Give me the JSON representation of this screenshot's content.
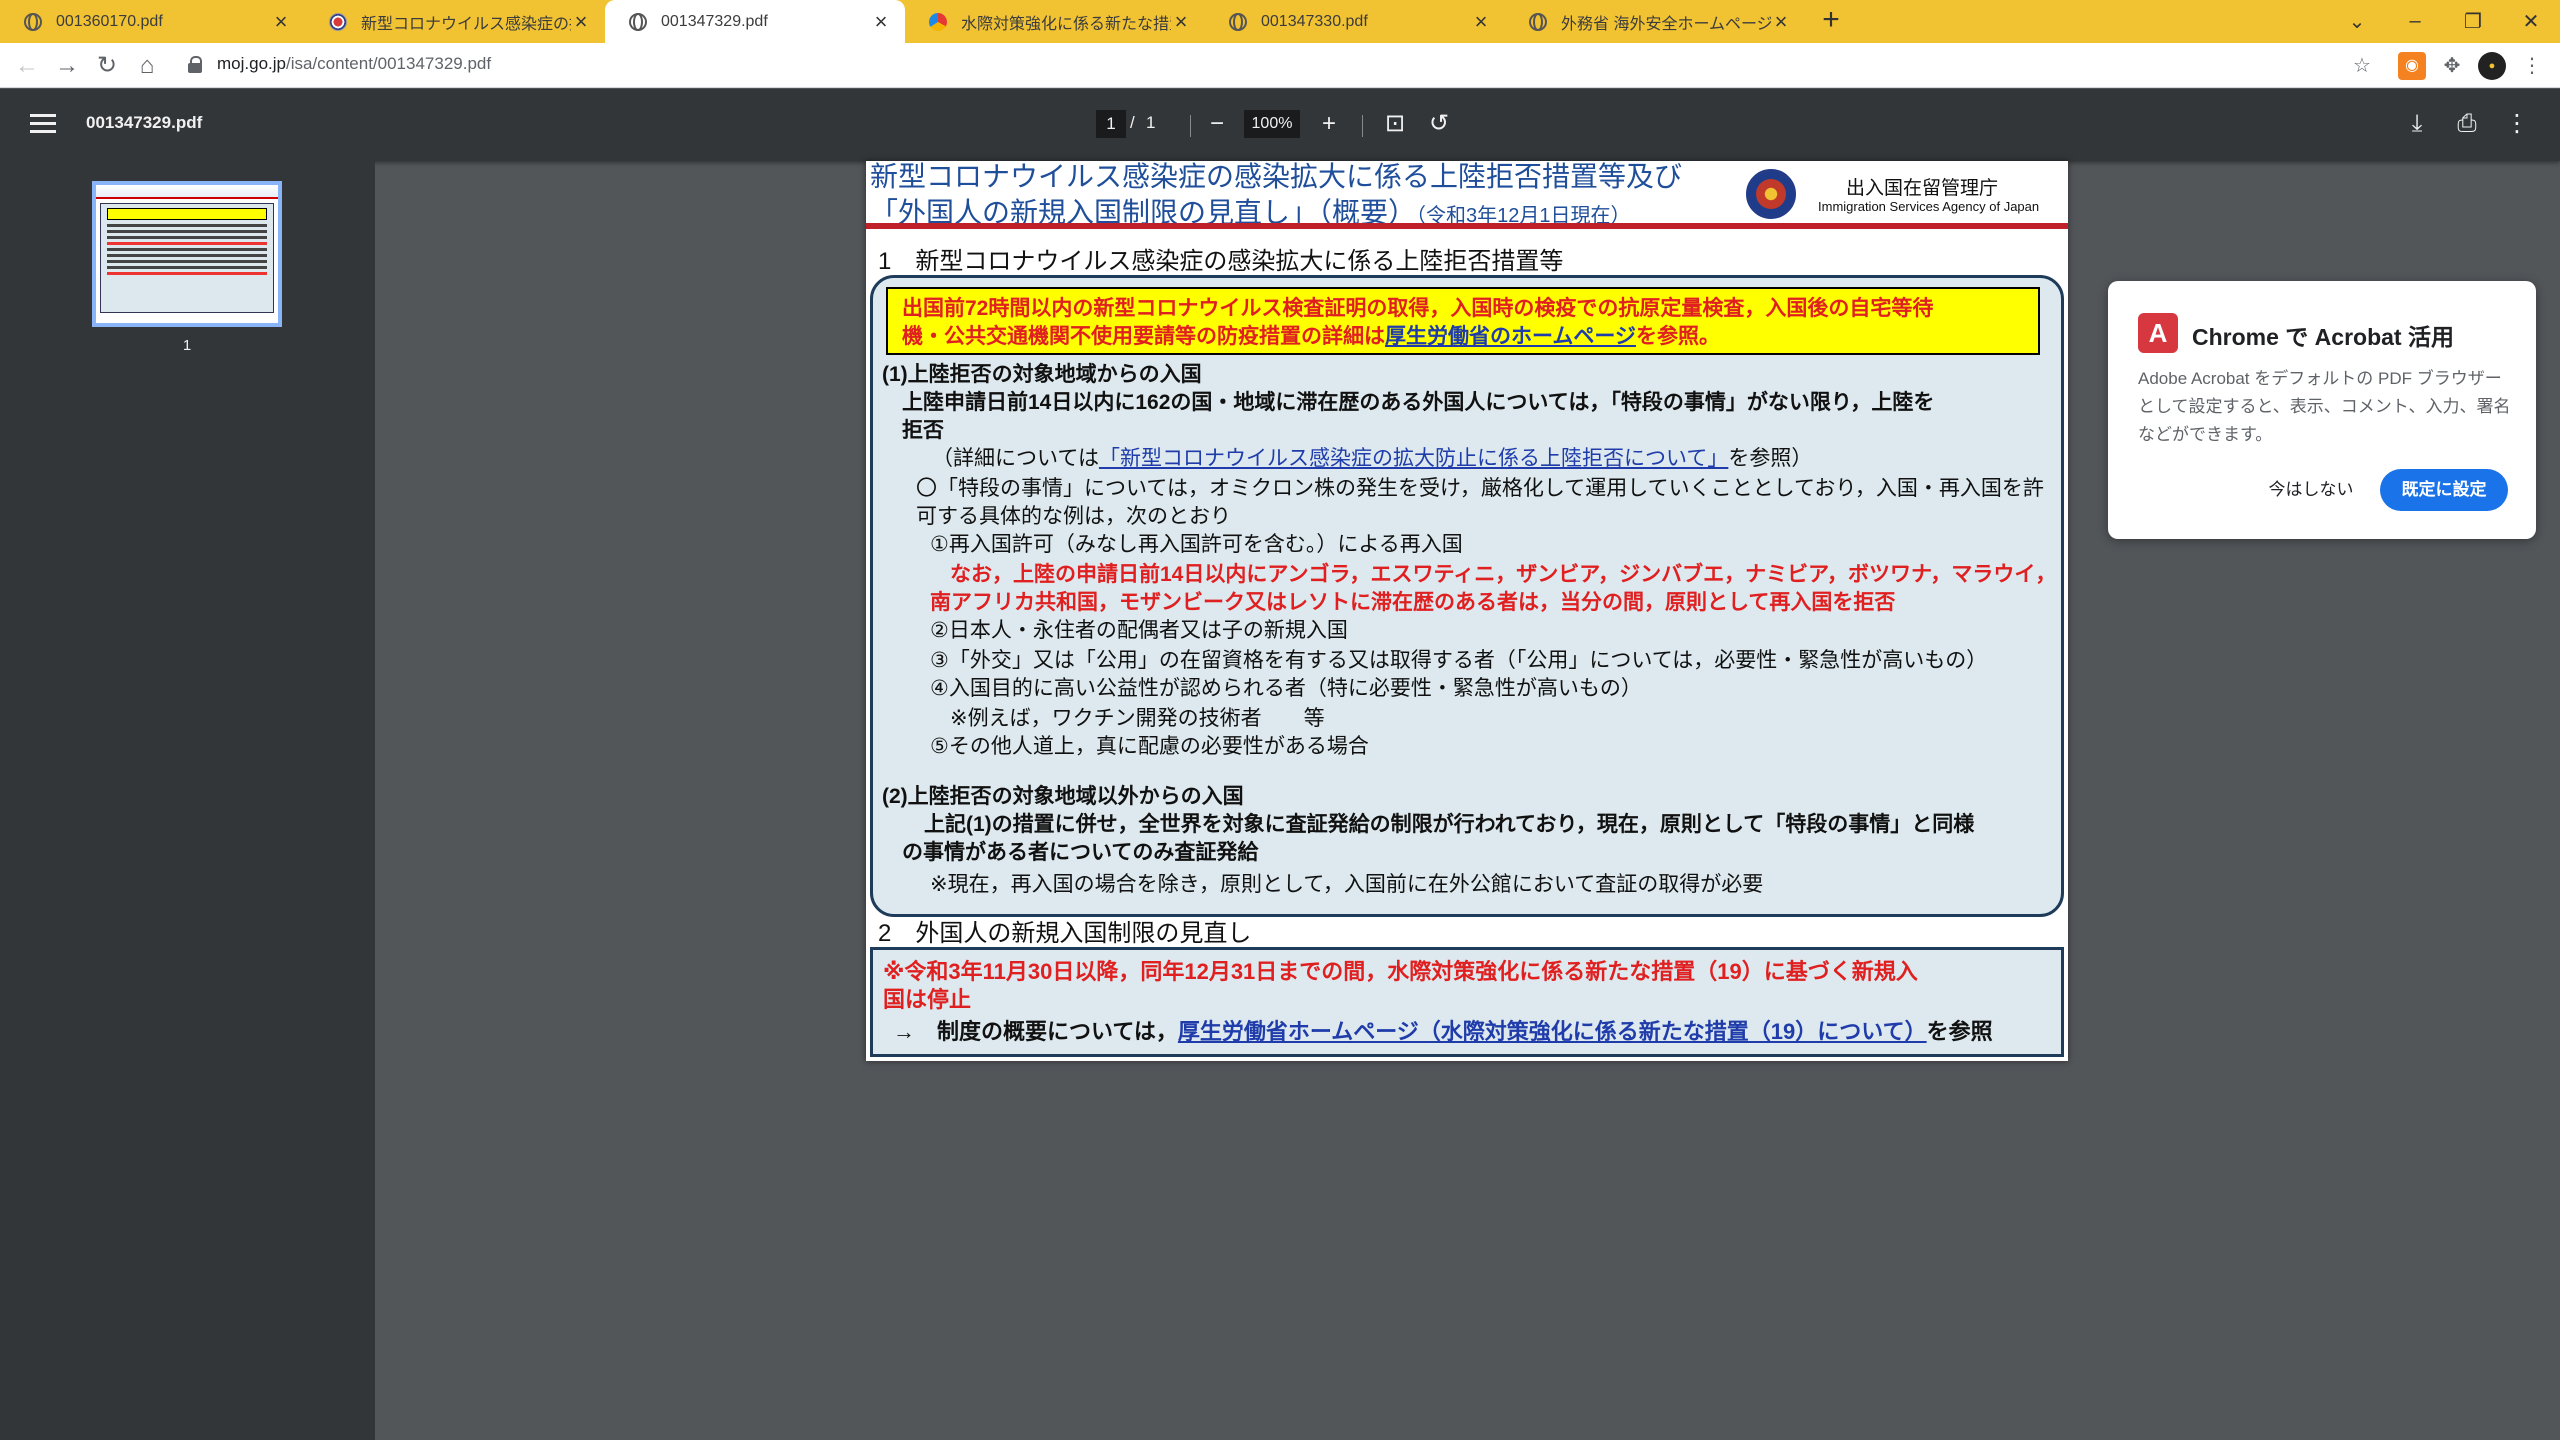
{
  "tabs": [
    {
      "title": "001360170.pdf",
      "icon": "globe-icon"
    },
    {
      "title": "新型コロナウイルス感染症の拡大防止",
      "icon": "flag-icon"
    },
    {
      "title": "001347329.pdf",
      "icon": "globe-icon",
      "active": true
    },
    {
      "title": "水際対策強化に係る新たな措置（",
      "icon": "maff-icon"
    },
    {
      "title": "001347330.pdf",
      "icon": "globe-icon"
    },
    {
      "title": "外務省 海外安全ホームページ",
      "icon": "globe-icon"
    }
  ],
  "address": {
    "host": "moj.go.jp",
    "path": "/isa/content/001347329.pdf"
  },
  "pdf_toolbar": {
    "doc_name": "001347329.pdf",
    "page_current": "1",
    "page_sep": "/",
    "page_total": "1",
    "zoom": "100%"
  },
  "sidebar": {
    "thumb_label": "1"
  },
  "doc": {
    "title_line1": "新型コロナウイルス感染症の感染拡大に係る上陸拒否措置等及び",
    "title_line2": "「外国人の新規入国制限の見直し」（概要）",
    "title_date": "（令和3年12月1日現在）",
    "agency_jp": "出入国在留管理庁",
    "agency_en": "Immigration Services Agency of Japan",
    "section1": "1　新型コロナウイルス感染症の感染拡大に係る上陸拒否措置等",
    "yellow_line1": "出国前72時間以内の新型コロナウイルス検査証明の取得，入国時の検疫での抗原定量検査，入国後の自宅等待",
    "yellow_line2a": "機・公共交通機関不使用要請等の防疫措置の詳細は",
    "yellow_link": "厚生労働省のホームページ",
    "yellow_line2b": "を参照。",
    "p1_head": "(1)上陸拒否の対象地域からの入国",
    "p1_l1": "上陸申請日前14日以内に162の国・地域に滞在歴のある外国人については，「特段の事情」がない限り，上陸を",
    "p1_l2": "拒否",
    "p1_l3a": "（詳細については",
    "p1_l3_link": "「新型コロナウイルス感染症の拡大防止に係る上陸拒否について」",
    "p1_l3b": "を参照）",
    "p1_l4": "〇「特段の事情」については，オミクロン株の発生を受け，厳格化して運用していくこととしており，入国・再入国を許",
    "p1_l5": "可する具体的な例は，次のとおり",
    "p1_l6": "①再入国許可（みなし再入国許可を含む。）による再入国",
    "p1_red1": "なお，上陸の申請日前14日以内にアンゴラ，エスワティニ，ザンビア，ジンバブエ，ナミビア，ボツワナ，マラウイ，",
    "p1_red2": "南アフリカ共和国，モザンビーク又はレソトに滞在歴のある者は，当分の間，原則として再入国を拒否",
    "p1_l7": "②日本人・永住者の配偶者又は子の新規入国",
    "p1_l8": "③「外交」又は「公用」の在留資格を有する又は取得する者（「公用」については，必要性・緊急性が高いもの）",
    "p1_l9": "④入国目的に高い公益性が認められる者（特に必要性・緊急性が高いもの）",
    "p1_l10": "※例えば，ワクチン開発の技術者　　等",
    "p1_l11": "⑤その他人道上，真に配慮の必要性がある場合",
    "p2_head": "(2)上陸拒否の対象地域以外からの入国",
    "p2_l1": "上記(1)の措置に併せ，全世界を対象に査証発給の制限が行われており，現在，原則として「特段の事情」と同様",
    "p2_l2": "の事情がある者についてのみ査証発給",
    "p2_l3": "※現在，再入国の場合を除き，原則として，入国前に在外公館において査証の取得が必要",
    "section2": "2　外国人の新規入国制限の見直し",
    "s2_red1": "※令和3年11月30日以降，同年12月31日までの間，水際対策強化に係る新たな措置（19）に基づく新規入",
    "s2_red2": "国は停止",
    "s2_l1a": "→　制度の概要については，",
    "s2_link": "厚生労働省ホームページ（水際対策強化に係る新たな措置（19）について）",
    "s2_l1b": "を参照"
  },
  "popup": {
    "title": "Chrome で Acrobat 活用",
    "body": "Adobe Acrobat をデフォルトの PDF ブラウザーとして設定すると、表示、コメント、入力、署名などができます。",
    "btn_later": "今はしない",
    "btn_default": "既定に設定"
  },
  "colors": {
    "tabstrip": "#f1c232",
    "pdf_toolbar": "#323639",
    "viewer_bg": "#525659",
    "doc_blue": "#1f4e9a",
    "doc_red": "#e02020",
    "highlight": "#ffff00",
    "accent": "#1a73e8"
  }
}
